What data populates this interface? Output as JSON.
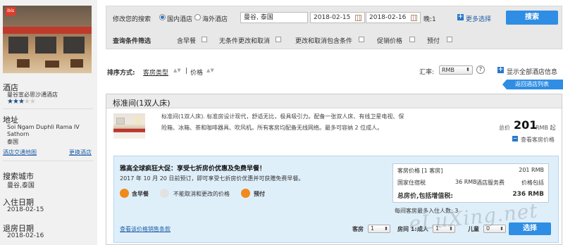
{
  "sidebar": {
    "hotel_heading": "酒店",
    "hotel_name": "曼谷宣必思沙通酒店",
    "stars_filled": 3,
    "stars_total": 5,
    "address_heading": "地址",
    "address_line1": "Soi Ngam Duphli Rama IV",
    "address_line2": "Sathorn",
    "address_line3": "泰国",
    "traffic_map_link": "酒店交通地图",
    "change_hotel_link": "更换酒店",
    "search_city_heading": "搜索城市",
    "search_city_value": "曼谷,泰国",
    "checkin_heading": "入住日期",
    "checkin_value": "2018-02-15",
    "checkout_heading": "退房日期",
    "checkout_value": "2018-02-16"
  },
  "search": {
    "modify_label": "修改您的搜索",
    "domestic_label": "国内酒店",
    "overseas_label": "海外酒店",
    "city_value": "曼谷, 泰国",
    "checkin_value": "2018-02-15",
    "checkout_value": "2018-02-16",
    "nights_label": "晚:1",
    "more_options": "更多选择",
    "search_button": "搜索",
    "filter_label": "查询条件筛选",
    "filters": [
      "含早餐",
      "无条件更改和取消",
      "更改和取消包含条件",
      "促销价格",
      "预付"
    ]
  },
  "sort": {
    "label": "排序方式:",
    "room_type": "客房类型",
    "separator": "|",
    "price": "价格",
    "currency_label": "汇率:",
    "currency_value": "RMB",
    "help": "?",
    "show_all": "显示全部酒店信息",
    "back_to_list": "返回酒店列表"
  },
  "room": {
    "title": "标准间(1双人床)",
    "desc_line1": "标准间(1双人床). 标准房设计现代，舒适无比，极具吸引力。配备一张双人床、有线卫星电视、保",
    "desc_line2": "险箱、冰箱、茶和咖啡器具、吹风机。所有客房均配备无线网络。最多可容纳 2 位成人。",
    "total_label": "总价",
    "price": "201",
    "price_unit": "RMB 起",
    "view_price": "查看客房价格"
  },
  "promo": {
    "title": "雅高全球疯狂大促：享受七折房价优惠及免费早餐！",
    "subtitle": "2017 年 10 月 20 日前预订，即可享受七折房价优惠并可获赠免费早餐。",
    "feature_breakfast": "含早餐",
    "feature_no_cancel": "不能取消和更改的价格",
    "feature_prepay": "预付",
    "policy_link": "查看该价格销售条款",
    "price_box": {
      "room_price_label": "客房价格 [1 客房]",
      "room_price_value": "201 RMB",
      "local_tax_label": "国家住宿税",
      "local_tax_value": "36 RMB",
      "service_fee_label": "酒店服务费",
      "service_fee_value": "价格包括",
      "total_label": "总房价,包括增值税:",
      "total_value": "236 RMB"
    },
    "max_occupancy": "每间客房最多入住人数: 3",
    "rooms_label": "客房",
    "rooms_value": "1",
    "room_num_label": "房间 1:",
    "adults_label": "成人",
    "adults_value": "1",
    "children_label": "儿童",
    "children_value": "0",
    "select_button": "选择"
  },
  "watermark": "eLuXing.net",
  "colors": {
    "accent": "#2f8de4",
    "promo_bg": "#dfeffa",
    "sidebar_bg": "#f1f1f1",
    "feature_icon": "#f08a1c"
  }
}
